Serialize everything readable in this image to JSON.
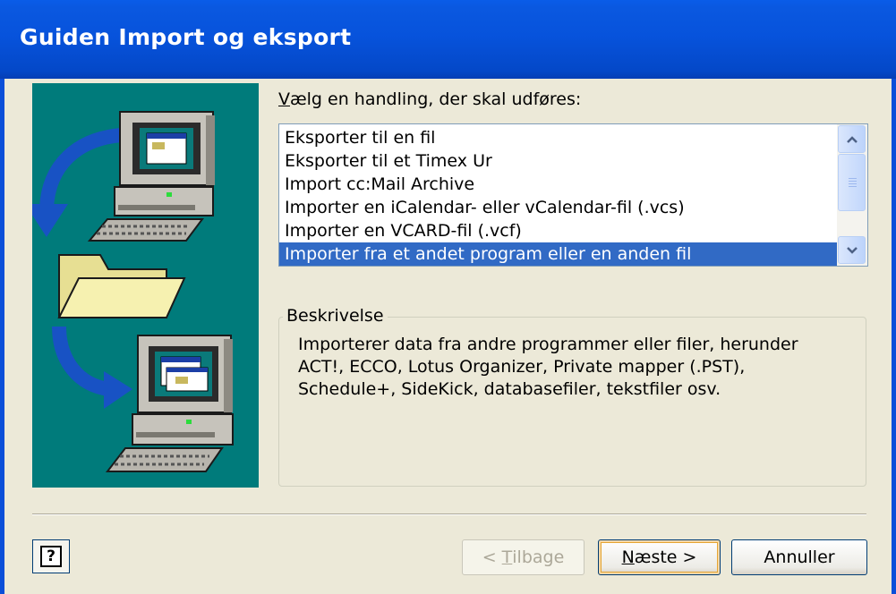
{
  "window": {
    "title": "Guiden Import og eksport"
  },
  "prompt": {
    "accel_char": "V",
    "rest": "ælg en handling, der skal udføres:"
  },
  "actions": {
    "items": [
      "Eksporter til en fil",
      "Eksporter til et Timex Ur",
      "Import cc:Mail Archive",
      "Importer en iCalendar- eller vCalendar-fil (.vcs)",
      "Importer en VCARD-fil (.vcf)",
      "Importer fra et andet program eller en anden fil"
    ],
    "selected_index": 5
  },
  "description": {
    "title": "Beskrivelse",
    "text": "Importerer data fra andre programmer eller filer, herunder\nACT!, ECCO, Lotus Organizer, Private mapper (.PST),\nSchedule+, SideKick, databasefiler, tekstfiler osv."
  },
  "buttons": {
    "back": {
      "pre": "< ",
      "accel": "T",
      "post": "ilbage"
    },
    "next": {
      "accel": "N",
      "post": "æste >"
    },
    "cancel": "Annuller",
    "help_glyph": "?"
  },
  "colors": {
    "titlebar": "#0753dc",
    "dialog_bg": "#ece9d8",
    "illustration_bg": "#007b7b",
    "selection": "#316ac5",
    "arrow": "#1852c4",
    "folder": "#f6f1b0"
  },
  "icons": [
    "monitor-icon",
    "folder-icon",
    "arrow-icon",
    "scroll-up-icon",
    "scroll-down-icon",
    "help-icon"
  ]
}
